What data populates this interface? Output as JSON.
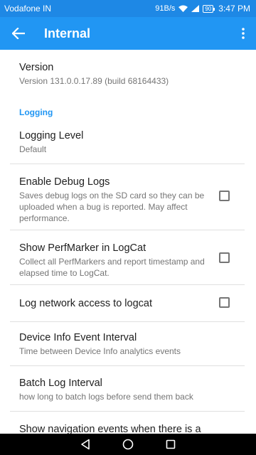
{
  "status_bar": {
    "carrier": "Vodafone IN",
    "speed": "91B/s",
    "battery": "90",
    "time": "3:47 PM"
  },
  "app_bar": {
    "title": "Internal",
    "back_icon": "arrow-back-icon",
    "menu_icon": "more-vert-icon"
  },
  "preferences": {
    "version": {
      "title": "Version",
      "summary": "Version 131.0.0.17.89 (build 68164433)"
    },
    "logging_category": "Logging",
    "logging_level": {
      "title": "Logging Level",
      "summary": "Default"
    },
    "debug_logs": {
      "title": "Enable Debug Logs",
      "summary": "Saves debug logs on the SD card so they can be uploaded when a bug is reported. May affect performance.",
      "checked": false
    },
    "perfmarker": {
      "title": "Show PerfMarker in LogCat",
      "summary": "Collect all PerfMarkers and report timestamp and elapsed time to LogCat.",
      "checked": false
    },
    "network_logcat": {
      "title": "Log network access to logcat",
      "checked": false
    },
    "device_info": {
      "title": "Device Info Event Interval",
      "summary": "Time between Device Info analytics events"
    },
    "batch_log": {
      "title": "Batch Log Interval",
      "summary": "how long to batch logs before send them back"
    },
    "nav_events": {
      "title": "Show navigation events when there is a"
    }
  },
  "colors": {
    "status_bar": "#1e88e5",
    "app_bar": "#2196f3",
    "accent": "#2196f3"
  }
}
